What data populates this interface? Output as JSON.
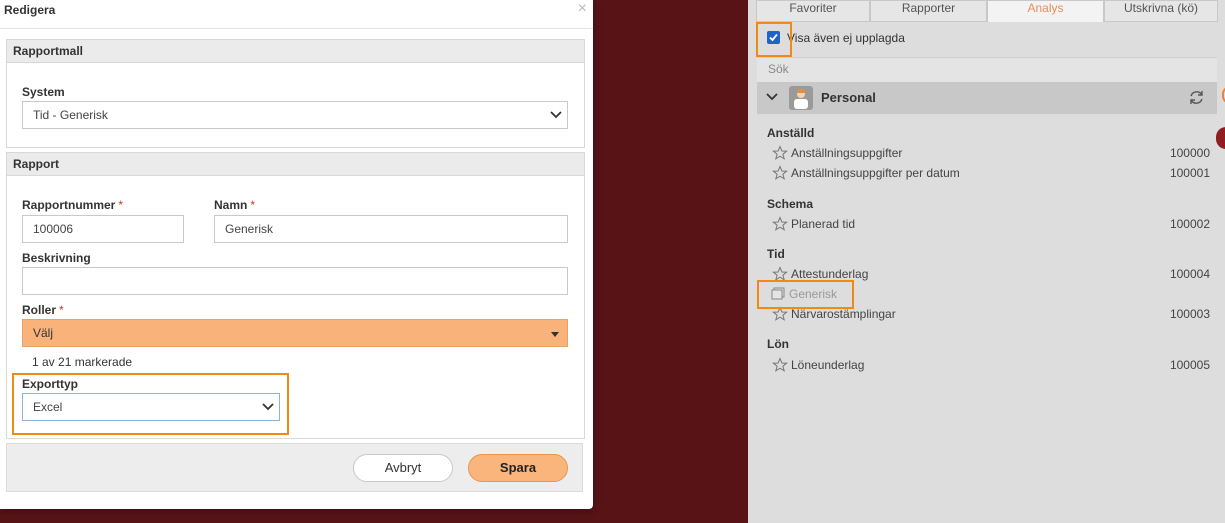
{
  "modal": {
    "title": "Redigera",
    "close_symbol": "×",
    "section_template": {
      "header": "Rapportmall",
      "system_label": "System",
      "system_value": "Tid - Generisk"
    },
    "section_report": {
      "header": "Rapport",
      "number_label": "Rapportnummer",
      "number_value": "100006",
      "name_label": "Namn",
      "name_value": "Generisk",
      "description_label": "Beskrivning",
      "description_value": "",
      "roles_label": "Roller",
      "roles_value": "Välj",
      "roles_summary": "1 av 21 markerade",
      "export_label": "Exporttyp",
      "export_value": "Excel",
      "required_mark": "*"
    },
    "footer": {
      "cancel_label": "Avbryt",
      "save_label": "Spara"
    }
  },
  "panel": {
    "tabs": [
      {
        "label": "Favoriter",
        "active": false
      },
      {
        "label": "Rapporter",
        "active": false
      },
      {
        "label": "Analys",
        "active": true
      },
      {
        "label": "Utskrivna (kö)",
        "active": false
      }
    ],
    "show_unpublished_label": "Visa även ej upplagda",
    "show_unpublished_checked": true,
    "search_placeholder": "Sök",
    "group": {
      "title": "Personal",
      "icon": "person-icon"
    },
    "categories": [
      {
        "name": "Anställd",
        "items": [
          {
            "label": "Anställningsuppgifter",
            "number": "100000"
          },
          {
            "label": "Anställningsuppgifter per datum",
            "number": "100001"
          }
        ]
      },
      {
        "name": "Schema",
        "items": [
          {
            "label": "Planerad tid",
            "number": "100002"
          }
        ]
      },
      {
        "name": "Tid",
        "items": [
          {
            "label": "Attestunderlag",
            "number": "100004"
          },
          {
            "label": "Generisk",
            "number": ""
          },
          {
            "label": "Närvarostämplingar",
            "number": "100003"
          }
        ]
      },
      {
        "name": "Lön",
        "items": [
          {
            "label": "Löneunderlag",
            "number": "100005"
          }
        ]
      }
    ]
  },
  "colors": {
    "backdrop": "#581317",
    "highlight": "#f08a14",
    "roles_bg": "#f8b27a",
    "save_bg": "#f9b57b",
    "active_tab": "#e58f57",
    "checkbox": "#1e63c6"
  }
}
